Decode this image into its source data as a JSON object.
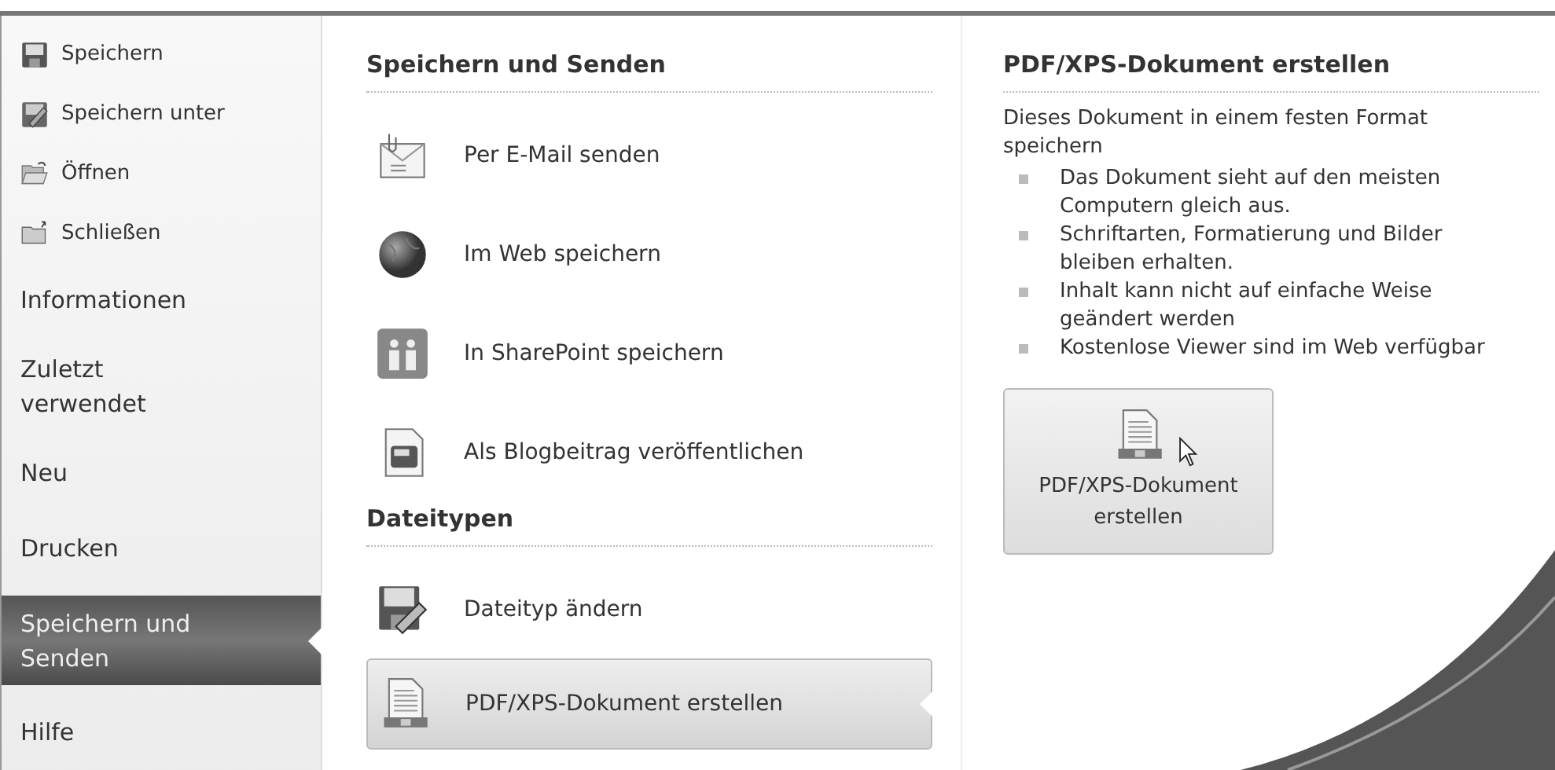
{
  "sidebar": {
    "items": [
      {
        "kind": "command",
        "label": "Speichern",
        "selected": false
      },
      {
        "kind": "command",
        "label": "Speichern unter",
        "selected": false
      },
      {
        "kind": "command",
        "label": "Öffnen",
        "selected": false
      },
      {
        "kind": "command",
        "label": "Schließen",
        "selected": false
      },
      {
        "kind": "page",
        "label": "Informationen",
        "selected": false
      },
      {
        "kind": "page",
        "label": "Zuletzt verwendet",
        "selected": false
      },
      {
        "kind": "page",
        "label": "Neu",
        "selected": false
      },
      {
        "kind": "page",
        "label": "Drucken",
        "selected": false
      },
      {
        "kind": "page",
        "label": "Speichern und Senden",
        "selected": true
      },
      {
        "kind": "page",
        "label": "Hilfe",
        "selected": false
      }
    ]
  },
  "sections": [
    {
      "heading": "Speichern und Senden",
      "items": [
        {
          "kind": "email",
          "label": "Per E-Mail senden",
          "selected": false
        },
        {
          "kind": "web",
          "label": "Im Web speichern",
          "selected": false
        },
        {
          "kind": "sharepoint",
          "label": "In SharePoint speichern",
          "selected": false
        },
        {
          "kind": "blog",
          "label": "Als Blogbeitrag veröffentlichen",
          "selected": false
        }
      ]
    },
    {
      "heading": "Dateitypen",
      "items": [
        {
          "kind": "filetype",
          "label": "Dateityp ändern",
          "selected": false
        },
        {
          "kind": "pdf",
          "label": "PDF/XPS-Dokument erstellen",
          "selected": true
        }
      ]
    }
  ],
  "detail": {
    "title": "PDF/XPS-Dokument erstellen",
    "description": "Dieses Dokument in einem festen Format speichern",
    "bullets": [
      "Das Dokument sieht auf den meisten Computern gleich aus.",
      "Schriftarten, Formatierung und Bilder bleiben erhalten.",
      "Inhalt kann nicht auf einfache Weise geändert werden",
      "Kostenlose Viewer sind im Web verfügbar"
    ],
    "button": "PDF/XPS-Dokument erstellen"
  }
}
